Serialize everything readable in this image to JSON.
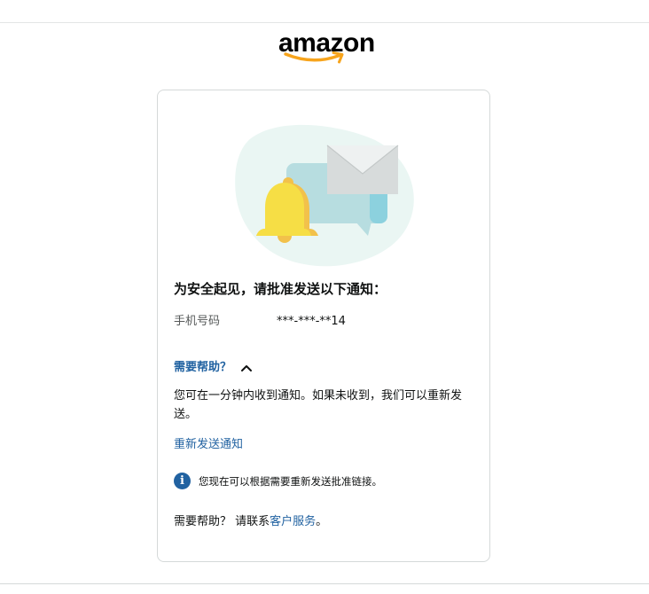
{
  "brand": {
    "logo_text": "amazon",
    "logo_color": "#000000",
    "smile_color": "#f7a41c"
  },
  "illustration": {
    "icons": [
      "bell-icon",
      "chat-bubble-icon",
      "envelope-icon"
    ]
  },
  "card": {
    "heading": "为安全起见，请批准发送以下通知：",
    "phone": {
      "label": "手机号码",
      "value": "***-***-**14"
    },
    "help": {
      "toggle_label": "需要帮助？",
      "expanded": true,
      "body": "您可在一分钟内收到通知。如果未收到，我们可以重新发送。",
      "resend_link": "重新发送通知"
    },
    "info": {
      "icon": "info-icon",
      "text": "您现在可以根据需要重新发送批准链接。"
    },
    "contact": {
      "prefix": "需要帮助？ 请联系",
      "link": "客户服务",
      "suffix": "。"
    }
  },
  "colors": {
    "link": "#2162a1",
    "text": "#0f1111",
    "muted": "#565959",
    "border": "#d5d9d9"
  }
}
